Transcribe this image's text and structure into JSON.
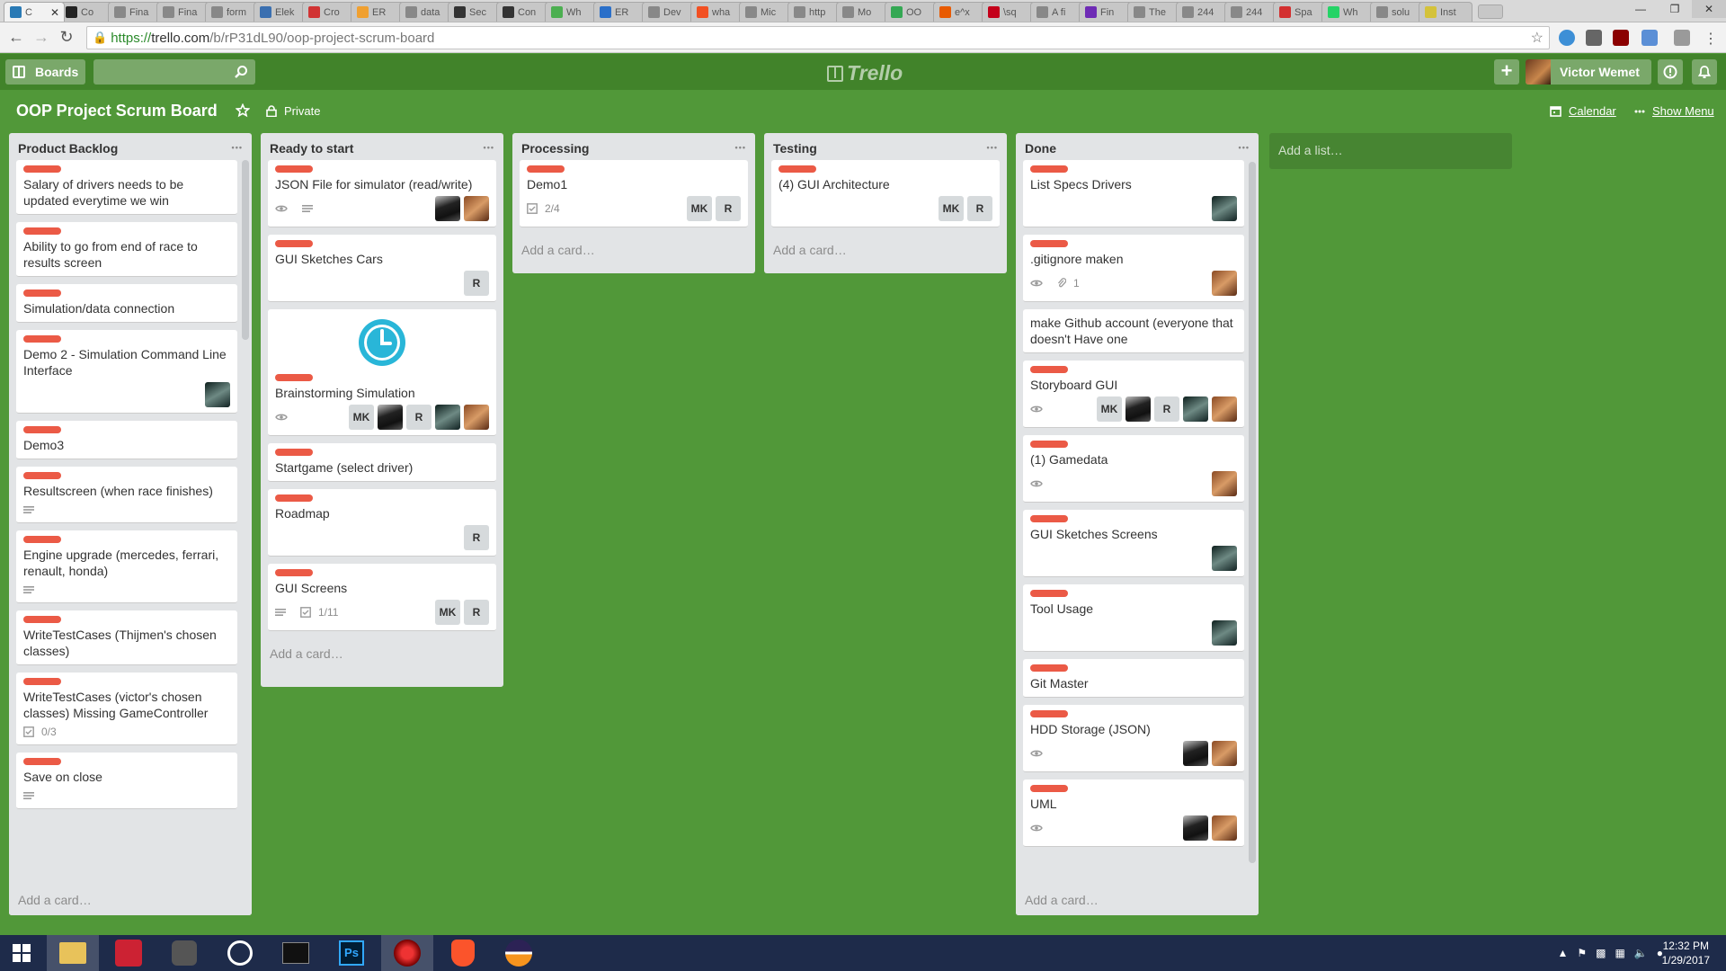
{
  "browser": {
    "tabs": [
      "C",
      "Co",
      "Fina",
      "Fina",
      "form",
      "Elek",
      "Cro",
      "ER",
      "data",
      "Sec",
      "Con",
      "Wh",
      "ER",
      "Dev",
      "wha",
      "Mic",
      "http",
      "Mo",
      "OO",
      "e^x",
      "\\sq",
      "A fi",
      "Fin",
      "The",
      "244",
      "244",
      "Spa",
      "Wh",
      "solu",
      "Inst"
    ],
    "tab_colors": [
      "#2a7ab5",
      "#222",
      "#888",
      "#888",
      "#888",
      "#3a6fb0",
      "#d13333",
      "#f0a030",
      "#888",
      "#333",
      "#333",
      "#4caf50",
      "#2a6fc9",
      "#888",
      "#f25022",
      "#888",
      "#888",
      "#888",
      "#34a853",
      "#e85a00",
      "#c4001a",
      "#888",
      "#6e2bb5",
      "#888",
      "#888",
      "#888",
      "#d32f2f",
      "#25d366",
      "#888",
      "#d4c23a"
    ],
    "url_prefix": "https://",
    "url_host": "trello.com",
    "url_path": "/b/rP31dL90/oop-project-scrum-board"
  },
  "header": {
    "boards_label": "Boards",
    "logo_text": "Trello",
    "user_name": "Victor Wemet"
  },
  "board": {
    "title": "OOP Project Scrum Board",
    "visibility": "Private",
    "calendar_label": "Calendar",
    "menu_label": "Show Menu",
    "add_list": "Add a list…",
    "add_card": "Add a card…"
  },
  "lists": [
    {
      "name": "Product Backlog",
      "cards": [
        {
          "title": "Salary of drivers needs to be updated everytime we win"
        },
        {
          "title": "Ability to go from end of race to results screen"
        },
        {
          "title": "Simulation/data connection"
        },
        {
          "title": "Demo 2 - Simulation Command Line Interface",
          "members": [
            "ph-c"
          ]
        },
        {
          "title": "Demo3"
        },
        {
          "title": "Resultscreen (when race finishes)",
          "desc": true
        },
        {
          "title": "Engine upgrade (mercedes, ferrari, renault, honda)",
          "desc": true
        },
        {
          "title": "WriteTestCases (Thijmen's chosen classes)"
        },
        {
          "title": "WriteTestCases (victor's chosen classes) Missing GameController",
          "checklist": "0/3"
        },
        {
          "title": "Save on close",
          "desc": true
        }
      ]
    },
    {
      "name": "Ready to start",
      "cards": [
        {
          "title": "JSON File for simulator (read/write)",
          "watch": true,
          "desc": true,
          "members": [
            "ph-a",
            "ph-b"
          ]
        },
        {
          "title": "GUI Sketches Cars",
          "members": [
            "R"
          ]
        },
        {
          "title": "Brainstorming Simulation",
          "cover": "clock",
          "watch": true,
          "members": [
            "MK",
            "ph-a",
            "R",
            "ph-c",
            "ph-b"
          ]
        },
        {
          "title": "Startgame (select driver)"
        },
        {
          "title": "Roadmap",
          "members": [
            "R"
          ]
        },
        {
          "title": "GUI Screens",
          "desc": true,
          "checklist": "1/11",
          "members": [
            "MK",
            "R"
          ]
        }
      ]
    },
    {
      "name": "Processing",
      "cards": [
        {
          "title": "Demo1",
          "checklist": "2/4",
          "members": [
            "MK",
            "R"
          ]
        }
      ]
    },
    {
      "name": "Testing",
      "cards": [
        {
          "title": "(4) GUI Architecture",
          "members": [
            "MK",
            "R"
          ]
        }
      ]
    },
    {
      "name": "Done",
      "cards": [
        {
          "title": "List Specs Drivers",
          "members": [
            "ph-c"
          ]
        },
        {
          "title": ".gitignore maken",
          "watch": true,
          "attachments": "1",
          "members": [
            "ph-b"
          ]
        },
        {
          "title": "make Github account (everyone that doesn't Have one",
          "nolabel": true
        },
        {
          "title": "Storyboard GUI",
          "watch": true,
          "members": [
            "MK",
            "ph-a",
            "R",
            "ph-c",
            "ph-b"
          ]
        },
        {
          "title": "(1) Gamedata",
          "watch": true,
          "members": [
            "ph-b"
          ]
        },
        {
          "title": "GUI Sketches Screens",
          "members": [
            "ph-c"
          ]
        },
        {
          "title": "Tool Usage",
          "members": [
            "ph-c"
          ]
        },
        {
          "title": "Git Master"
        },
        {
          "title": "HDD Storage (JSON)",
          "watch": true,
          "members": [
            "ph-a",
            "ph-b"
          ]
        },
        {
          "title": "UML",
          "watch": true,
          "members": [
            "ph-a",
            "ph-b"
          ]
        }
      ]
    }
  ],
  "taskbar": {
    "time": "12:32 PM",
    "date": "1/29/2017"
  },
  "colors": {
    "board_bg": "#519839",
    "header_bg": "#41832a",
    "label_red": "#eb5a46",
    "list_bg": "#e2e4e6",
    "taskbar_bg": "#1e2b4a"
  }
}
